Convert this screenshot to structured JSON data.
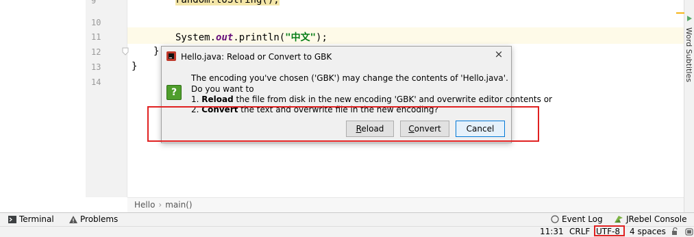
{
  "editor": {
    "line_numbers": [
      "9",
      "10",
      "11",
      "12",
      "13",
      "14"
    ],
    "partial_top_code": "random.toString();",
    "println_prefix": "System.",
    "println_out": "out",
    "println_call": ".println(",
    "println_string": "\"中文\"",
    "println_end": ");",
    "brace_inner": "}",
    "brace_outer": "}"
  },
  "breadcrumb": {
    "class": "Hello",
    "method": "main()",
    "separator": "›"
  },
  "right_strip": {
    "label": "Word Subtitles"
  },
  "tool_windows": {
    "terminal": "Terminal",
    "problems": "Problems",
    "event_log": "Event Log",
    "jrebel": "JRebel Console"
  },
  "status_bar": {
    "position": "11:31",
    "line_separator": "CRLF",
    "encoding": "UTF-8",
    "indent": "4 spaces"
  },
  "dialog": {
    "title": "Hello.java: Reload or Convert to GBK",
    "close": "×",
    "icon": "?",
    "line1": "The encoding you've chosen ('GBK') may change the contents of 'Hello.java'.",
    "line2": "Do you want to",
    "line3_prefix": "1. ",
    "line3_bold": "Reload",
    "line3_rest": " the file from disk in the new encoding 'GBK' and overwrite editor contents or",
    "line4_prefix": "2. ",
    "line4_bold": "Convert",
    "line4_rest": " the text and overwrite file in the new encoding?",
    "buttons": {
      "reload_mn": "R",
      "reload_rest": "eload",
      "convert_mn": "C",
      "convert_rest": "onvert",
      "cancel": "Cancel"
    }
  },
  "colors": {
    "annotation_red": "#e02020",
    "keyword_purple": "#660e7a",
    "string_green": "#067d17",
    "question_green": "#4f9e2c"
  }
}
